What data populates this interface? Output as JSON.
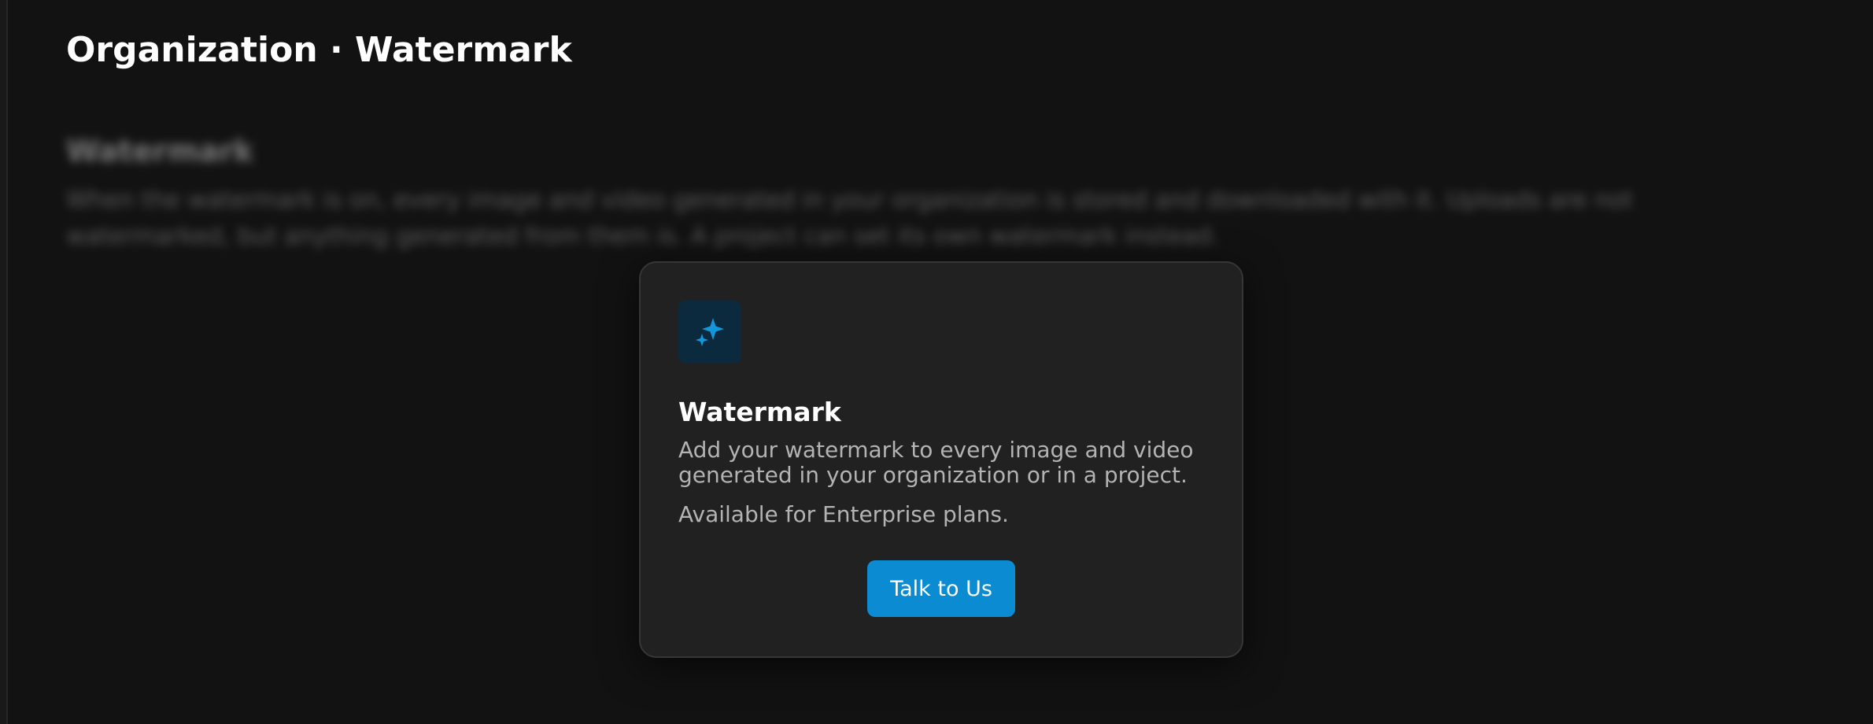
{
  "page": {
    "title": "Organization · Watermark"
  },
  "background_section": {
    "heading": "Watermark",
    "text": "When the watermark is on, every image and video generated in your organization is stored and downloaded with it. Uploads are not watermarked, but anything generated from them is. A project can set its own watermark instead."
  },
  "modal": {
    "icon": "sparkle-icon",
    "title": "Watermark",
    "description": "Add your watermark to every image and video generated in your organization or in a project.",
    "availability": "Available for Enterprise plans.",
    "button_label": "Talk to Us"
  },
  "colors": {
    "background": "#121212",
    "modal_background": "#212121",
    "accent": "#0a8bd2",
    "icon_tile": "#0c2a3e"
  }
}
